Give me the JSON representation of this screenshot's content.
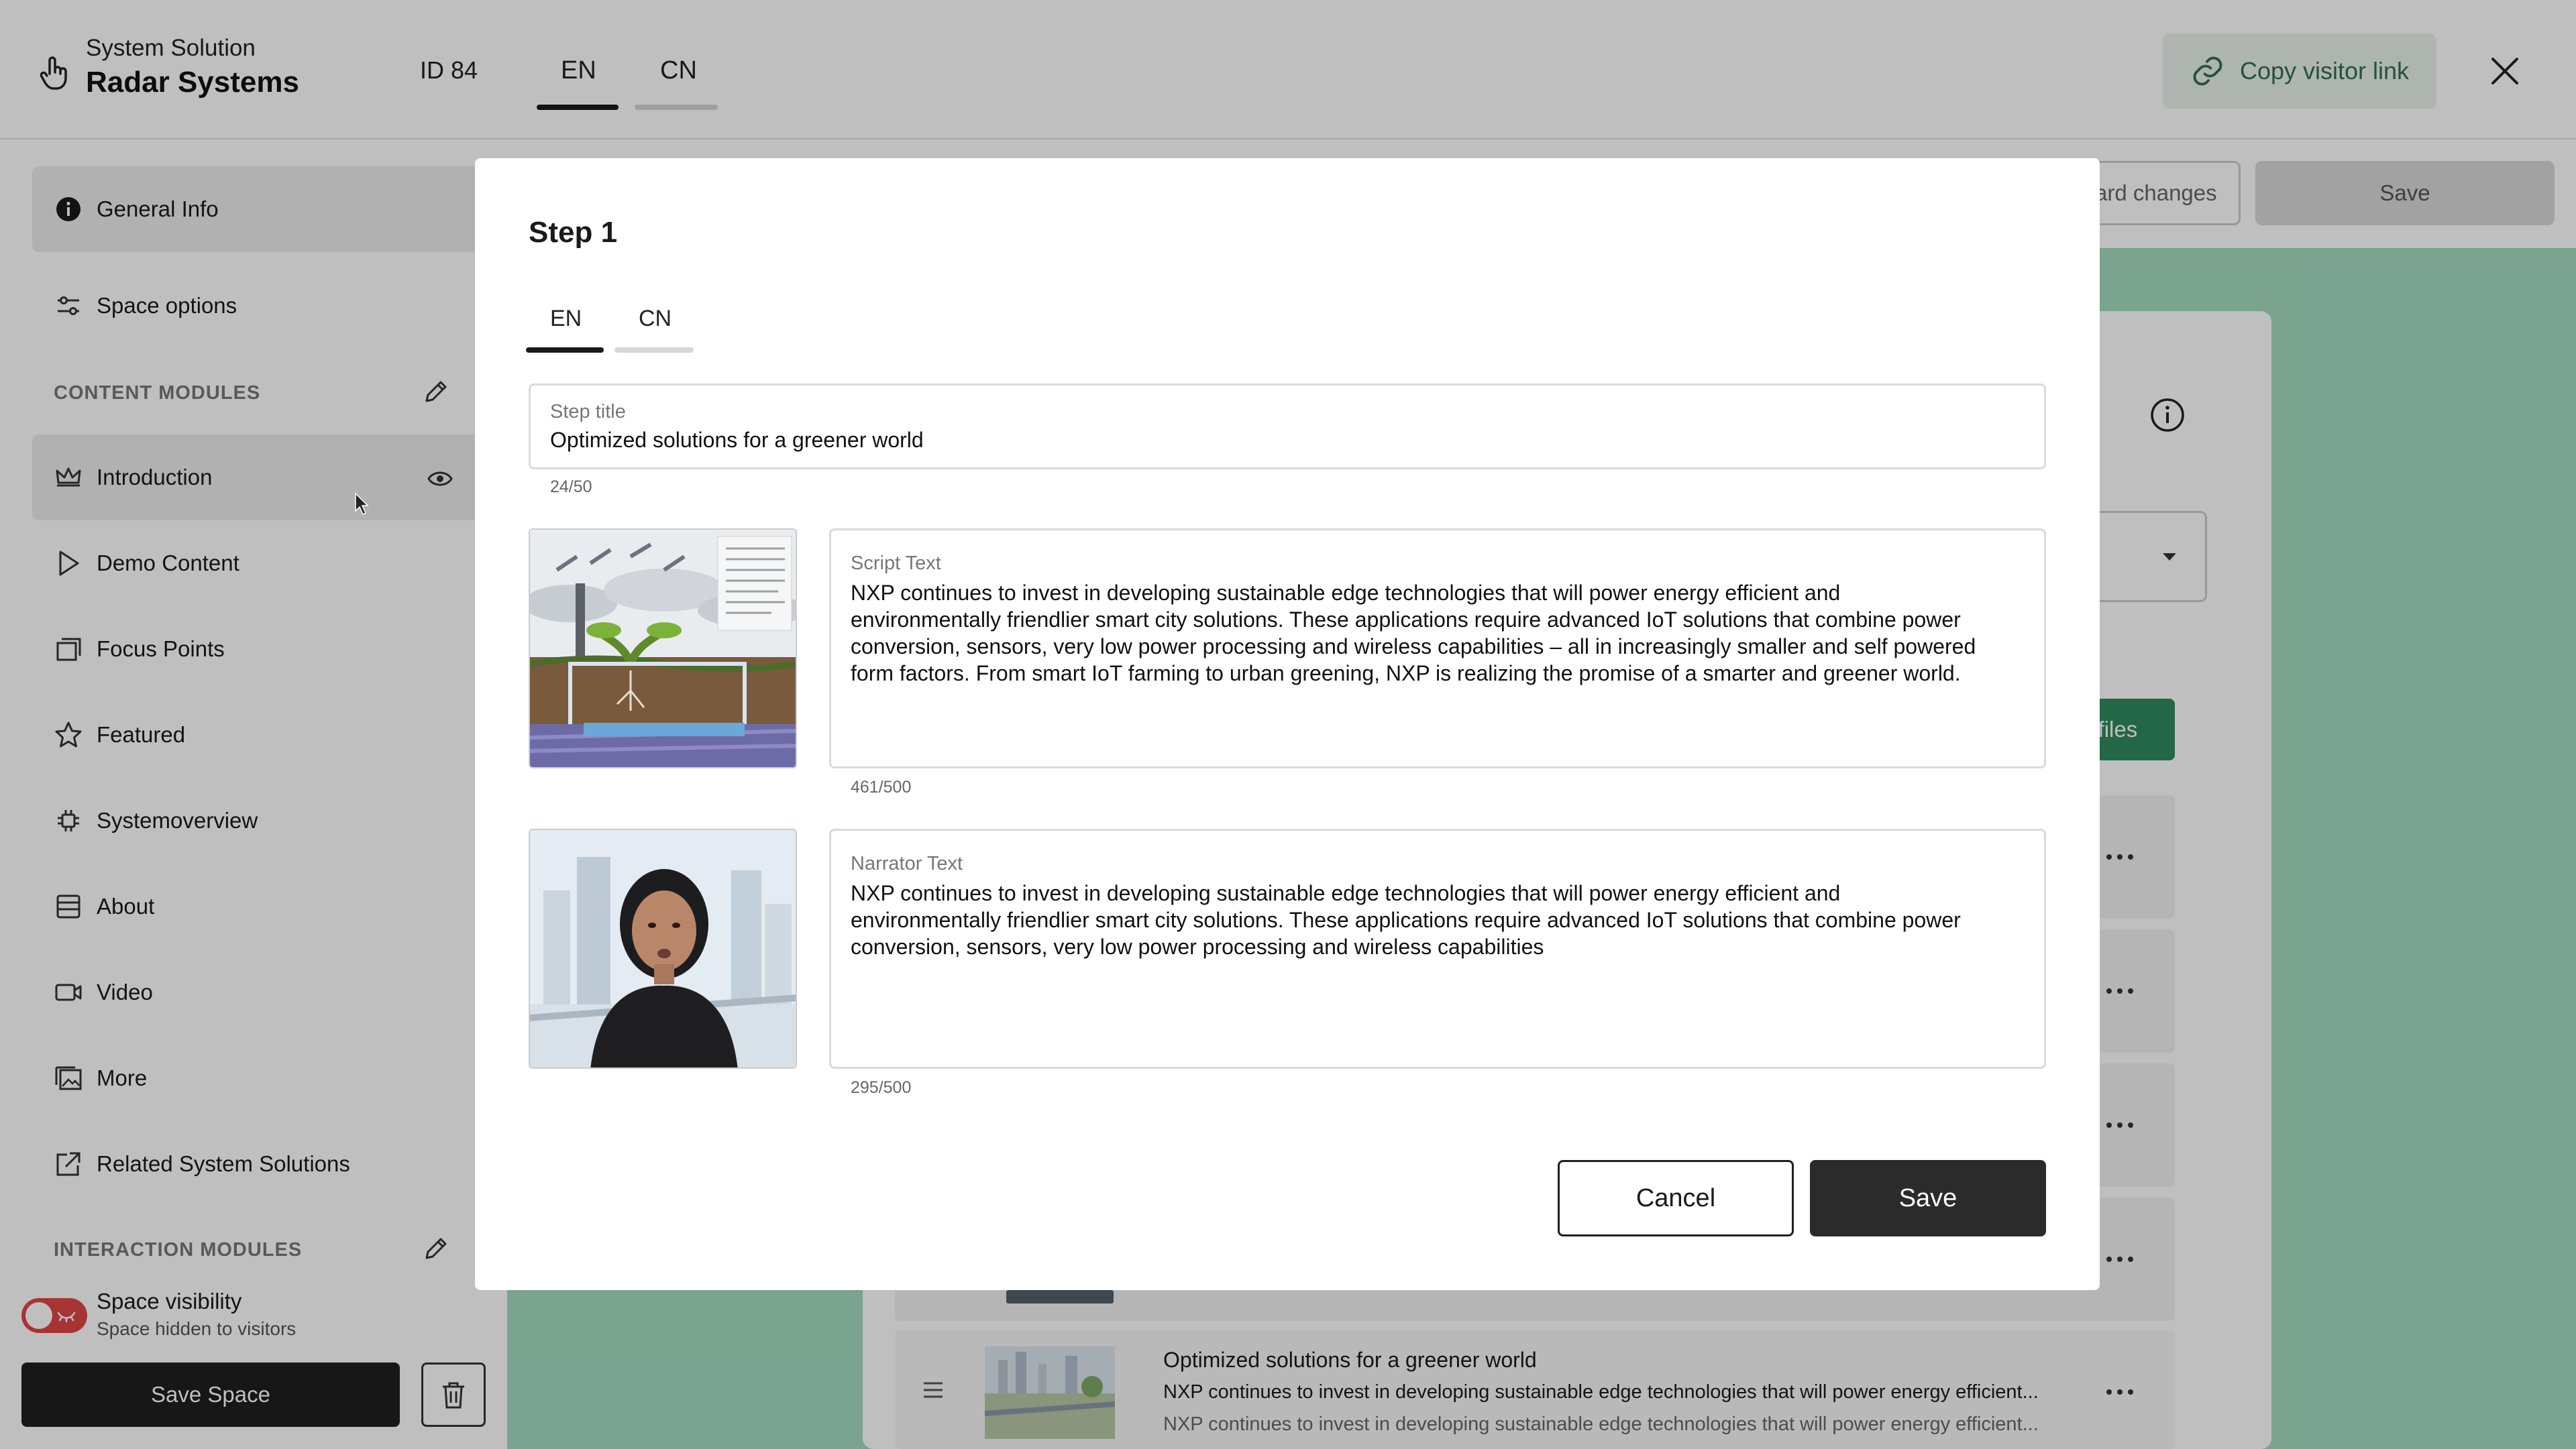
{
  "header": {
    "subtitle": "System Solution",
    "title": "Radar Systems",
    "id_label": "ID 84",
    "tabs": [
      {
        "label": "EN",
        "active": true
      },
      {
        "label": "CN",
        "active": false
      }
    ],
    "copy_link_label": "Copy visitor link"
  },
  "sidebar": {
    "general_info": "General Info",
    "space_options": "Space options",
    "content_modules_heading": "CONTENT MODULES",
    "items": [
      {
        "label": "Introduction",
        "icon": "crown-icon"
      },
      {
        "label": "Demo Content",
        "icon": "play-icon"
      },
      {
        "label": "Focus Points",
        "icon": "stack-icon"
      },
      {
        "label": "Featured",
        "icon": "star-icon"
      },
      {
        "label": "Systemoverview",
        "icon": "chip-icon"
      },
      {
        "label": "About",
        "icon": "list-icon"
      },
      {
        "label": "Video",
        "icon": "video-icon"
      },
      {
        "label": "More",
        "icon": "images-icon"
      },
      {
        "label": "Related System Solutions",
        "icon": "external-link-icon"
      }
    ],
    "interaction_modules_heading": "INTERACTION MODULES",
    "visibility_title": "Space visibility",
    "visibility_sub": "Space hidden to visitors",
    "save_space": "Save Space"
  },
  "main": {
    "discard_label": "ard changes",
    "save_label": "Save",
    "files_label": "d files",
    "last_row": {
      "title": "Optimized solutions for a greener world",
      "line1": "NXP continues to invest in developing sustainable edge technologies that will power energy efficient...",
      "line2": "NXP continues to invest in developing sustainable edge technologies that will power energy efficient..."
    }
  },
  "modal": {
    "title": "Step 1",
    "tabs": [
      {
        "label": "EN",
        "active": true
      },
      {
        "label": "CN",
        "active": false
      }
    ],
    "step_title": {
      "label": "Step title",
      "value": "Optimized solutions for a greener world",
      "counter": "24/50"
    },
    "script": {
      "label": "Script Text",
      "lines": [
        "NXP continues to invest in developing sustainable edge technologies that will power energy efficient and",
        "environmentally friendlier smart city solutions. These applications require advanced IoT solutions that combine power",
        "conversion, sensors, very low power processing and wireless capabilities – all in increasingly smaller and self powered",
        "form factors. From smart IoT farming to urban greening, NXP is realizing the promise of a smarter and greener world."
      ],
      "counter": "461/500"
    },
    "narrator": {
      "label": "Narrator Text",
      "lines": [
        "NXP continues to invest in developing sustainable edge technologies that will power energy efficient and",
        "environmentally friendlier smart city solutions. These applications require advanced IoT solutions that combine power",
        "conversion, sensors, very low power processing and wireless capabilities"
      ],
      "counter": "295/500"
    },
    "cancel_label": "Cancel",
    "save_label": "Save"
  },
  "colors": {
    "accent_green": "#2f8a60",
    "teal_bg": "#a3dac1",
    "toggle_off": "#e04545",
    "dark_button": "#2b2b2b"
  }
}
